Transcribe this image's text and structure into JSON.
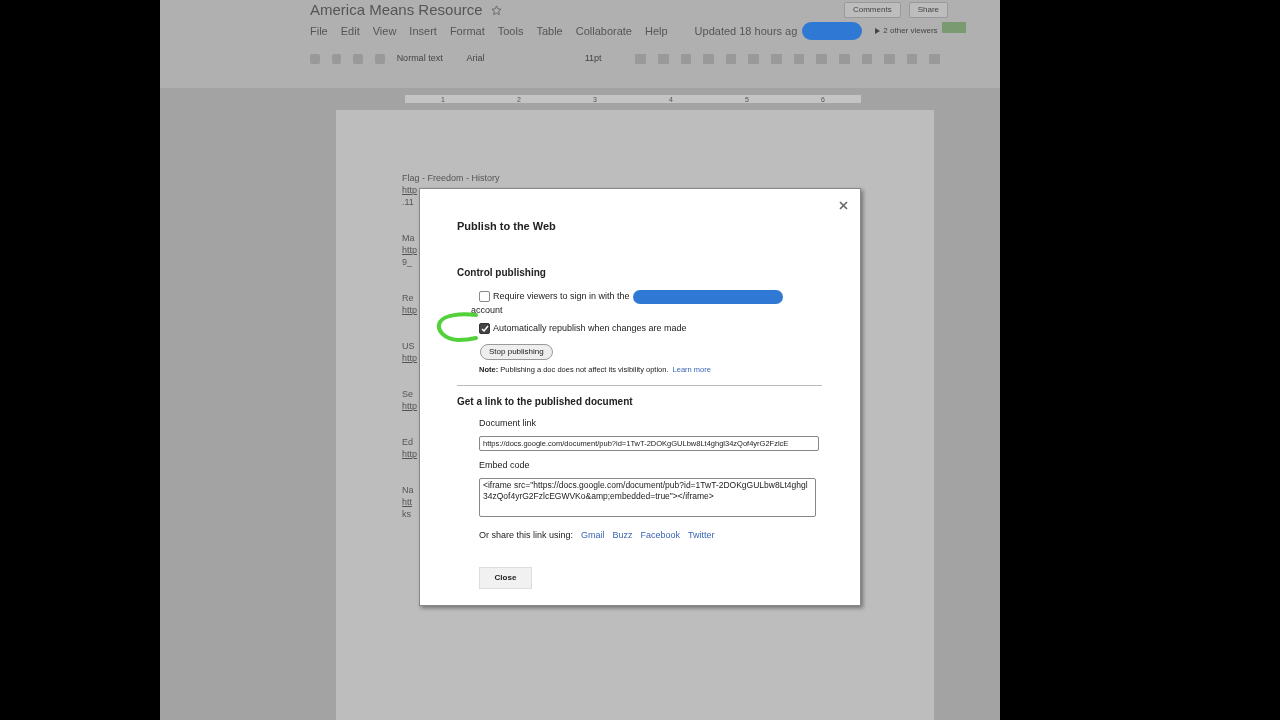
{
  "document": {
    "title": "America Means Resource",
    "menu": [
      "File",
      "Edit",
      "View",
      "Insert",
      "Format",
      "Tools",
      "Table",
      "Collaborate",
      "Help"
    ],
    "updated": "Updated 18 hours ag",
    "viewers": "2 other viewers",
    "buttons": [
      "Comments",
      "Share"
    ],
    "toolbar": {
      "style": "Normal text",
      "font": "Arial",
      "size": "11pt"
    },
    "ruler": [
      "1",
      "2",
      "3",
      "4",
      "5",
      "6"
    ],
    "lines": [
      [
        "Flag - Freedom - History",
        "http",
        ".11"
      ],
      [
        "Ma",
        "http",
        "9_"
      ],
      [
        "Re",
        "http"
      ],
      [
        "US",
        "http"
      ],
      [
        "Se",
        "http"
      ],
      [
        "Ed",
        "http"
      ],
      [
        "Na",
        "htt",
        "ks"
      ]
    ]
  },
  "dialog": {
    "title": "Publish to the Web",
    "section_1": "Control publishing",
    "options": [
      {
        "label": "Require viewers to sign in with the",
        "continuation": "account",
        "checked": false,
        "redacted": true
      },
      {
        "label": "Automatically republish when changes are made",
        "checked": true,
        "redacted": false
      }
    ],
    "stop_button": "Stop publishing",
    "note": "**Note:** Publishing a doc does not affect its visibility option.",
    "learn_more": "Learn more",
    "section_2": "Get a link to the published document",
    "link_label": "Document link",
    "link_value": "https://docs.google.com/document/pub?id=1TwT-2DOKgGULbw8Lt4ghgl34zQof4yrG2FzlcE",
    "embed_label": "Embed code",
    "embed_value": "<iframe src=\"https://docs.google.com/document/pub?id=1TwT-2DOKgGULbw8Lt4ghgl34zQof4yrG2FzlcEGWVKo&amp;embedded=true\"></iframe>",
    "share_label": "Or share this link using:",
    "share_links": [
      "Gmail",
      "Buzz",
      "Facebook",
      "Twitter"
    ],
    "close_button": "Close"
  }
}
